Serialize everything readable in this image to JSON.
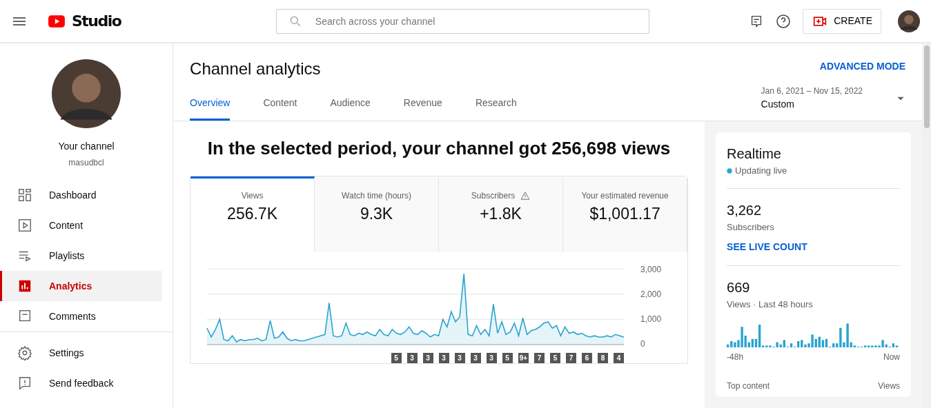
{
  "header": {
    "logo_text": "Studio",
    "search": {
      "placeholder": "Search across your channel"
    },
    "create_label": "CREATE"
  },
  "sidebar": {
    "channel_title": "Your channel",
    "channel_handle": "masudbcl",
    "items": [
      {
        "label": "Dashboard",
        "kind": "dashboard",
        "selected": false
      },
      {
        "label": "Content",
        "kind": "content",
        "selected": false
      },
      {
        "label": "Playlists",
        "kind": "playlists",
        "selected": false
      },
      {
        "label": "Analytics",
        "kind": "analytics",
        "selected": true
      },
      {
        "label": "Comments",
        "kind": "comments",
        "selected": false
      }
    ],
    "footer_items": [
      {
        "label": "Settings",
        "kind": "settings"
      },
      {
        "label": "Send feedback",
        "kind": "feedback"
      }
    ]
  },
  "page": {
    "title": "Channel analytics",
    "advanced_mode": "ADVANCED MODE",
    "date_range": "Jan 6, 2021 – Nov 15, 2022",
    "date_preset": "Custom",
    "tabs": [
      {
        "label": "Overview",
        "selected": true
      },
      {
        "label": "Content",
        "selected": false
      },
      {
        "label": "Audience",
        "selected": false
      },
      {
        "label": "Revenue",
        "selected": false
      },
      {
        "label": "Research",
        "selected": false
      }
    ]
  },
  "summary": {
    "headline": "In the selected period, your channel got 256,698 views",
    "metrics": [
      {
        "label": "Views",
        "value": "256.7K",
        "selected": true,
        "warning": false
      },
      {
        "label": "Watch time (hours)",
        "value": "9.3K",
        "selected": false,
        "warning": false
      },
      {
        "label": "Subscribers",
        "value": "+1.8K",
        "selected": false,
        "warning": true
      },
      {
        "label": "Your estimated revenue",
        "value": "$1,001.17",
        "selected": false,
        "warning": false
      }
    ],
    "chart_data": {
      "type": "area",
      "ylim": [
        0,
        3000
      ],
      "yticks": [
        0,
        {
          "value": 1000,
          "label": "1,000"
        },
        {
          "value": 2000,
          "label": "2,000"
        },
        {
          "value": 3000,
          "label": "3,000"
        }
      ],
      "series": [
        {
          "color": "#2aa3cf",
          "values": [
            650,
            300,
            600,
            1000,
            200,
            150,
            350,
            100,
            200,
            150,
            200,
            200,
            250,
            150,
            200,
            950,
            250,
            300,
            500,
            250,
            150,
            200,
            150,
            150,
            200,
            250,
            300,
            350,
            400,
            1650,
            350,
            300,
            350,
            850,
            400,
            350,
            450,
            400,
            500,
            400,
            350,
            600,
            400,
            350,
            600,
            450,
            400,
            500,
            700,
            450,
            400,
            550,
            450,
            300,
            400,
            350,
            1000,
            700,
            1300,
            900,
            1100,
            2800,
            400,
            350,
            750,
            400,
            600,
            350,
            1600,
            450,
            900,
            400,
            500,
            850,
            350,
            1050,
            400,
            550,
            600,
            700,
            850,
            900,
            650,
            750,
            350,
            700,
            450,
            500,
            400,
            450,
            350,
            300,
            350,
            300,
            300,
            350,
            300,
            400,
            350,
            300
          ]
        }
      ]
    },
    "markers": [
      "5",
      "3",
      "3",
      "3",
      "3",
      "3",
      "3",
      "5",
      "9+",
      "7",
      "5",
      "7",
      "6",
      "8",
      "4"
    ]
  },
  "realtime": {
    "title": "Realtime",
    "status": "Updating live",
    "subscribers": "3,262",
    "subscribers_label": "Subscribers",
    "live_count_link": "SEE LIVE COUNT",
    "views": "669",
    "views_label": "Views · Last 48 hours",
    "axis_start": "-48h",
    "axis_end": "Now",
    "top_content_label": "Top content",
    "top_content_views_label": "Views"
  }
}
